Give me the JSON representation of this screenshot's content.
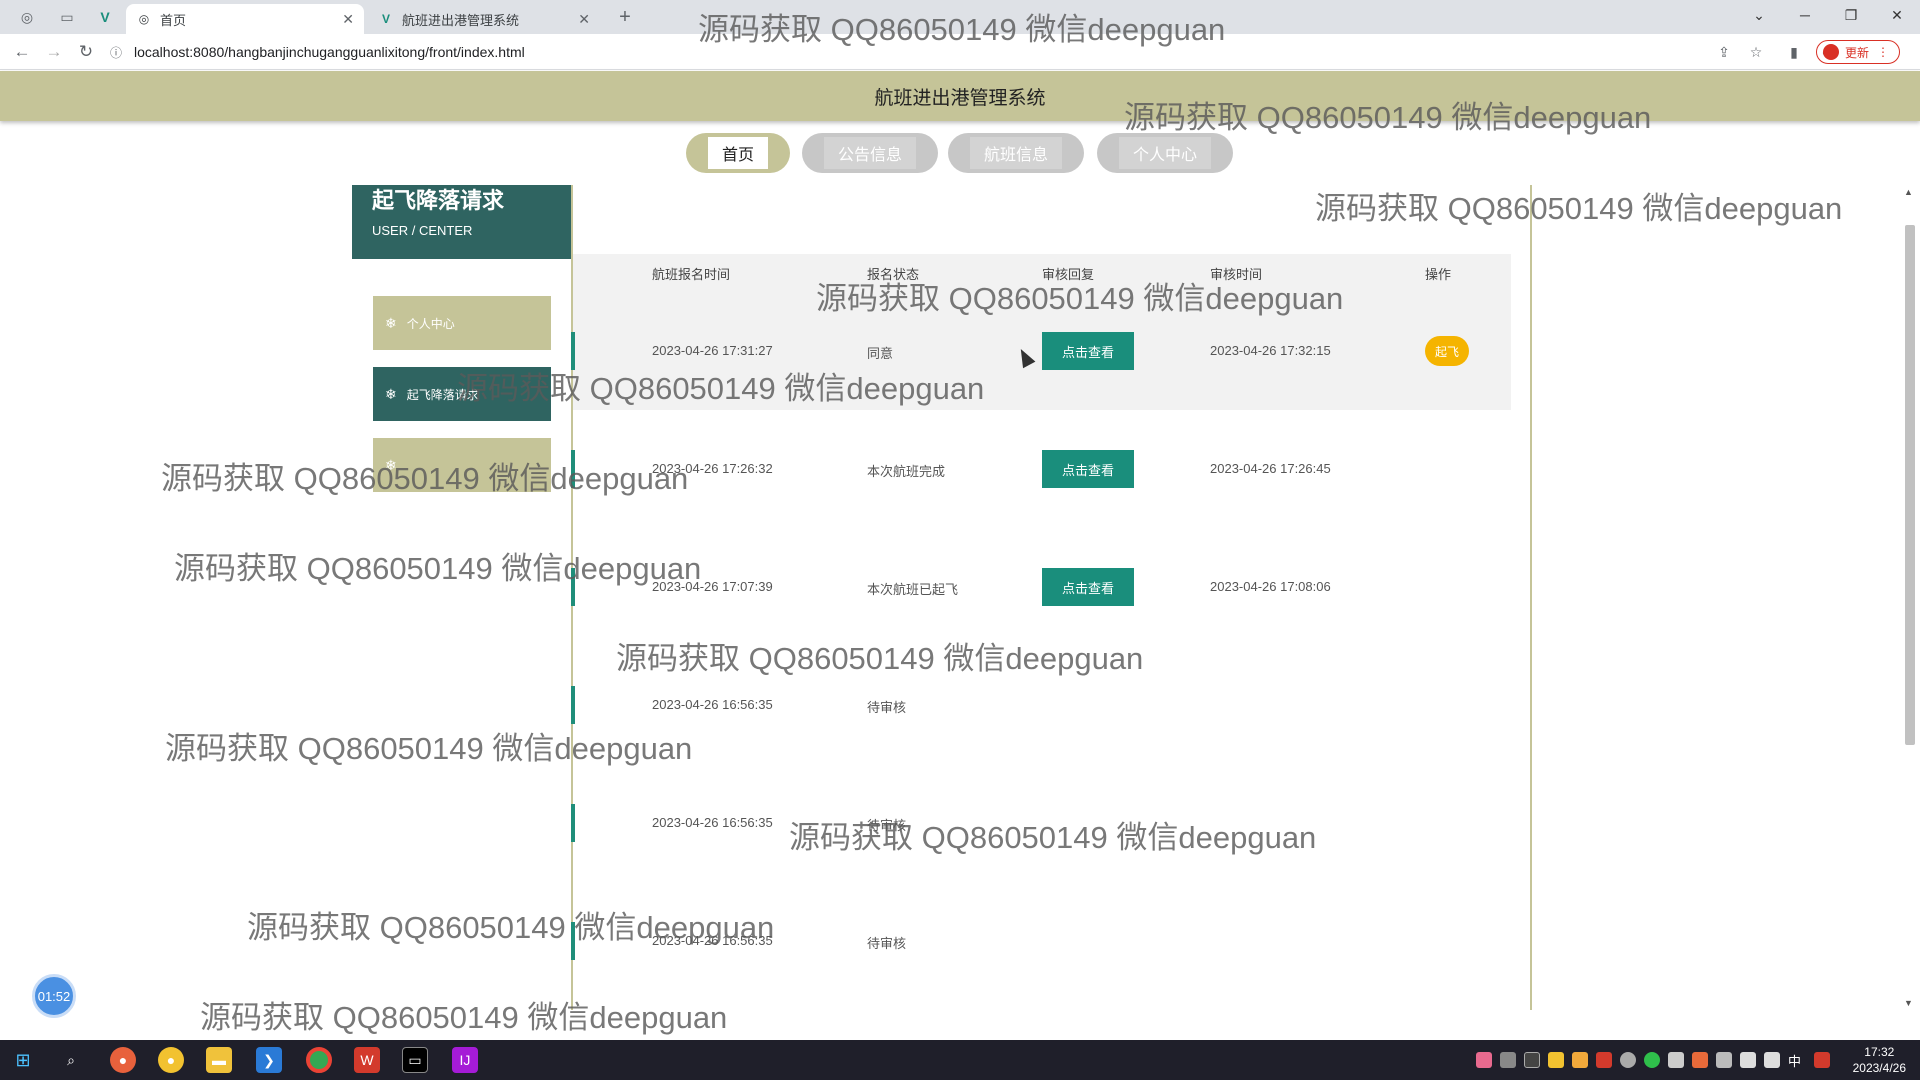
{
  "browser": {
    "tabs": [
      {
        "label": "首页",
        "active": true
      },
      {
        "label": "航班进出港管理系统",
        "active": false
      }
    ],
    "url": "localhost:8080/hangbanjinchugangguanlixitong/front/index.html",
    "update_label": "更新"
  },
  "site": {
    "title": "航班进出港管理系统",
    "nav": [
      {
        "label": "首页",
        "active": true
      },
      {
        "label": "公告信息",
        "active": false
      },
      {
        "label": "航班信息",
        "active": false
      },
      {
        "label": "个人中心",
        "active": false
      }
    ]
  },
  "sidebar": {
    "title": "起飞降落请求",
    "subtitle": "USER / CENTER",
    "items": [
      {
        "label": "个人中心",
        "active": false,
        "icon": "snowflake-icon"
      },
      {
        "label": "起飞降落请求",
        "active": true,
        "icon": "snowflake-icon"
      },
      {
        "label": "",
        "active": false,
        "icon": "snowflake-icon"
      }
    ]
  },
  "table": {
    "headers": [
      "航班报名时间",
      "报名状态",
      "审核回复",
      "审核时间",
      "操作"
    ],
    "view_label": "点击查看",
    "takeoff_label": "起飞",
    "rows": [
      {
        "time": "2023-04-26 17:31:27",
        "status": "同意",
        "has_view": true,
        "review_time": "2023-04-26 17:32:15",
        "has_action": true
      },
      {
        "time": "2023-04-26 17:26:32",
        "status": "本次航班完成",
        "has_view": true,
        "review_time": "2023-04-26 17:26:45",
        "has_action": false
      },
      {
        "time": "2023-04-26 17:07:39",
        "status": "本次航班已起飞",
        "has_view": true,
        "review_time": "2023-04-26 17:08:06",
        "has_action": false
      },
      {
        "time": "2023-04-26 16:56:35",
        "status": "待审核",
        "has_view": false,
        "review_time": "",
        "has_action": false
      },
      {
        "time": "2023-04-26 16:56:35",
        "status": "待审核",
        "has_view": false,
        "review_time": "",
        "has_action": false
      },
      {
        "time": "2023-04-26 16:56:35",
        "status": "待审核",
        "has_view": false,
        "review_time": "",
        "has_action": false
      }
    ]
  },
  "timer": "01:52",
  "watermark": "源码获取 QQ86050149 微信deepguan",
  "clock": {
    "time": "17:32",
    "date": "2023/4/26"
  },
  "tray_ime": "中"
}
